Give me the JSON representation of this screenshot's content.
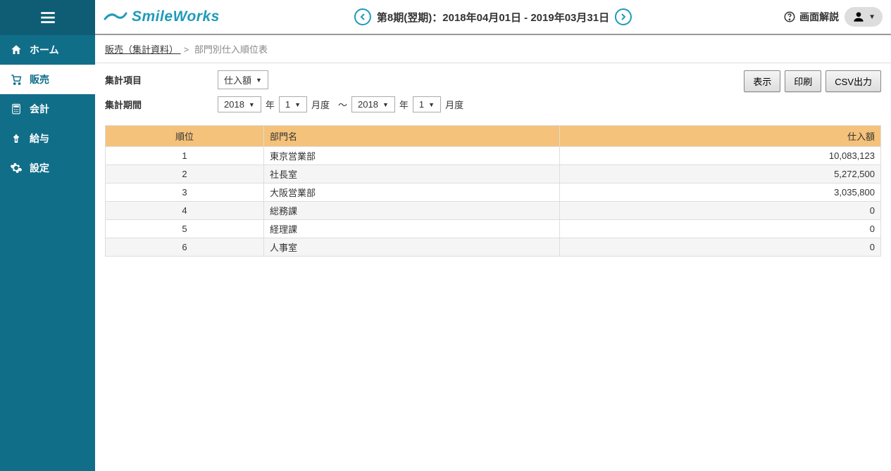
{
  "brand": "SmileWorks",
  "header": {
    "period_label": "第8期(翌期)：2018年04月01日 - 2019年03月31日",
    "help_label": "画面解説"
  },
  "sidebar": {
    "items": [
      {
        "label": "ホーム",
        "icon": "home"
      },
      {
        "label": "販売",
        "icon": "cart"
      },
      {
        "label": "会計",
        "icon": "calc"
      },
      {
        "label": "給与",
        "icon": "money"
      },
      {
        "label": "設定",
        "icon": "gear"
      }
    ]
  },
  "breadcrumb": {
    "parent": " 販売（集計資料） ",
    "current": "部門別仕入順位表"
  },
  "filters": {
    "item_label": "集計項目",
    "item_value": "仕入額",
    "period_label": "集計期間",
    "from_year": "2018",
    "from_month": "1",
    "to_year": "2018",
    "to_month": "1",
    "year_unit": "年",
    "month_unit": "月度",
    "range_sep": "～"
  },
  "buttons": {
    "show": "表示",
    "print": "印刷",
    "csv": "CSV出力"
  },
  "table": {
    "headers": {
      "rank": "順位",
      "dept": "部門名",
      "amount": "仕入額"
    },
    "rows": [
      {
        "rank": "1",
        "dept": "東京営業部",
        "amount": "10,083,123"
      },
      {
        "rank": "2",
        "dept": "社長室",
        "amount": "5,272,500"
      },
      {
        "rank": "3",
        "dept": "大阪営業部",
        "amount": "3,035,800"
      },
      {
        "rank": "4",
        "dept": "総務課",
        "amount": "0"
      },
      {
        "rank": "5",
        "dept": "経理課",
        "amount": "0"
      },
      {
        "rank": "6",
        "dept": "人事室",
        "amount": "0"
      }
    ]
  }
}
